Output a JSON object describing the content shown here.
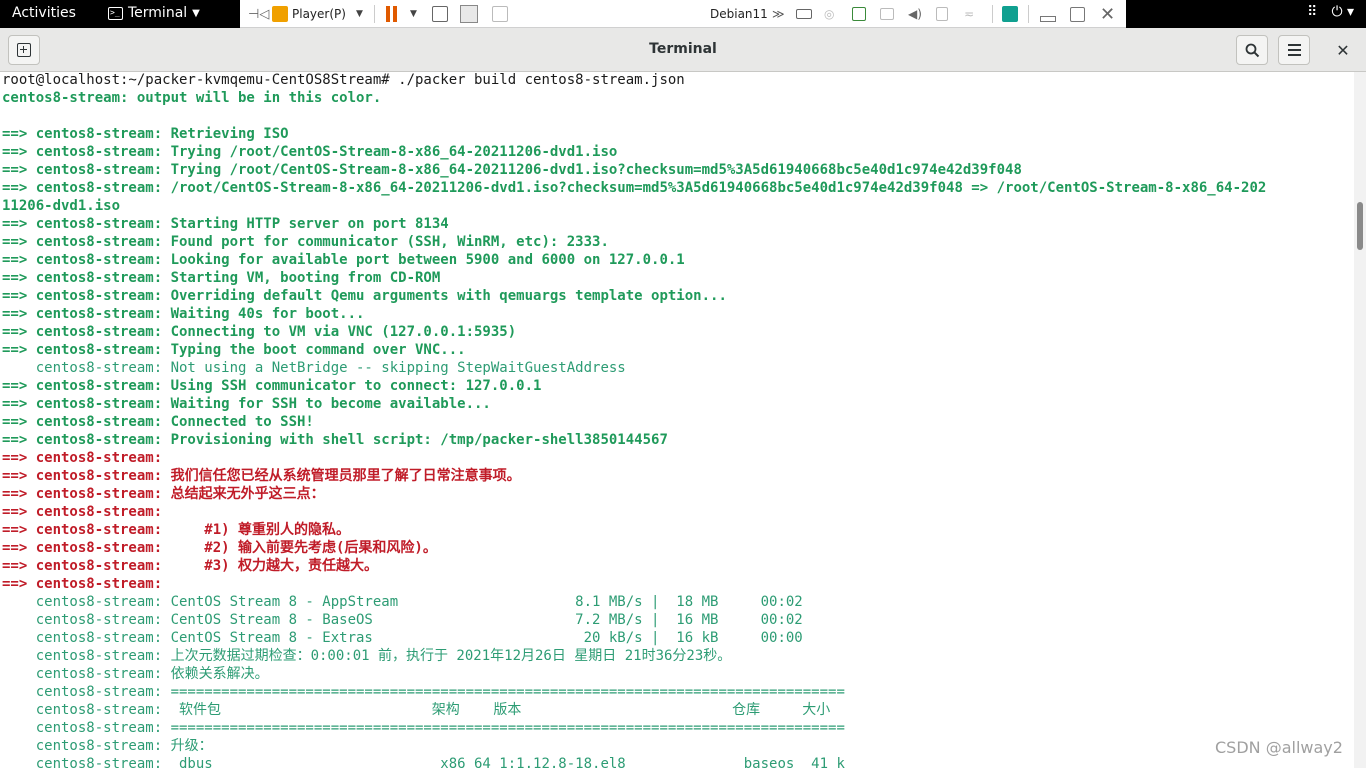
{
  "topbar": {
    "activities": "Activities",
    "app_name": "Terminal"
  },
  "vmware": {
    "player_label": "Player(P)",
    "vm_name": "Debian11"
  },
  "window": {
    "title": "Terminal"
  },
  "colors": {
    "prompt": "#1a1a1a",
    "green": "#1f9a5a",
    "dim_green": "#2d9c74",
    "red": "#c01c28"
  },
  "terminal_lines": [
    {
      "c": "white",
      "t": "root@localhost:~/packer-kvmqemu-CentOS8Stream# ./packer build centos8-stream.json"
    },
    {
      "c": "green",
      "t": "centos8-stream: output will be in this color."
    },
    {
      "c": "green",
      "t": ""
    },
    {
      "c": "green",
      "t": "==> centos8-stream: Retrieving ISO"
    },
    {
      "c": "green",
      "t": "==> centos8-stream: Trying /root/CentOS-Stream-8-x86_64-20211206-dvd1.iso"
    },
    {
      "c": "green",
      "t": "==> centos8-stream: Trying /root/CentOS-Stream-8-x86_64-20211206-dvd1.iso?checksum=md5%3A5d61940668bc5e40d1c974e42d39f048"
    },
    {
      "c": "green",
      "t": "==> centos8-stream: /root/CentOS-Stream-8-x86_64-20211206-dvd1.iso?checksum=md5%3A5d61940668bc5e40d1c974e42d39f048 => /root/CentOS-Stream-8-x86_64-202"
    },
    {
      "c": "green",
      "t": "11206-dvd1.iso"
    },
    {
      "c": "green",
      "t": "==> centos8-stream: Starting HTTP server on port 8134"
    },
    {
      "c": "green",
      "t": "==> centos8-stream: Found port for communicator (SSH, WinRM, etc): 2333."
    },
    {
      "c": "green",
      "t": "==> centos8-stream: Looking for available port between 5900 and 6000 on 127.0.0.1"
    },
    {
      "c": "green",
      "t": "==> centos8-stream: Starting VM, booting from CD-ROM"
    },
    {
      "c": "green",
      "t": "==> centos8-stream: Overriding default Qemu arguments with qemuargs template option..."
    },
    {
      "c": "green",
      "t": "==> centos8-stream: Waiting 40s for boot..."
    },
    {
      "c": "green",
      "t": "==> centos8-stream: Connecting to VM via VNC (127.0.0.1:5935)"
    },
    {
      "c": "green",
      "t": "==> centos8-stream: Typing the boot command over VNC..."
    },
    {
      "c": "dimgreen",
      "t": "    centos8-stream: Not using a NetBridge -- skipping StepWaitGuestAddress"
    },
    {
      "c": "green",
      "t": "==> centos8-stream: Using SSH communicator to connect: 127.0.0.1"
    },
    {
      "c": "green",
      "t": "==> centos8-stream: Waiting for SSH to become available..."
    },
    {
      "c": "green",
      "t": "==> centos8-stream: Connected to SSH!"
    },
    {
      "c": "green",
      "t": "==> centos8-stream: Provisioning with shell script: /tmp/packer-shell3850144567"
    },
    {
      "c": "red",
      "t": "==> centos8-stream:"
    },
    {
      "c": "red",
      "t": "==> centos8-stream: 我们信任您已经从系统管理员那里了解了日常注意事项。"
    },
    {
      "c": "red",
      "t": "==> centos8-stream: 总结起来无外乎这三点："
    },
    {
      "c": "red",
      "t": "==> centos8-stream:"
    },
    {
      "c": "red",
      "t": "==> centos8-stream:     #1) 尊重别人的隐私。"
    },
    {
      "c": "red",
      "t": "==> centos8-stream:     #2) 输入前要先考虑(后果和风险)。"
    },
    {
      "c": "red",
      "t": "==> centos8-stream:     #3) 权力越大，责任越大。"
    },
    {
      "c": "red",
      "t": "==> centos8-stream:"
    },
    {
      "c": "dimgreen",
      "t": "    centos8-stream: CentOS Stream 8 - AppStream                     8.1 MB/s |  18 MB     00:02"
    },
    {
      "c": "dimgreen",
      "t": "    centos8-stream: CentOS Stream 8 - BaseOS                        7.2 MB/s |  16 MB     00:02"
    },
    {
      "c": "dimgreen",
      "t": "    centos8-stream: CentOS Stream 8 - Extras                         20 kB/s |  16 kB     00:00"
    },
    {
      "c": "dimgreen",
      "t": "    centos8-stream: 上次元数据过期检查：0:00:01 前，执行于 2021年12月26日 星期日 21时36分23秒。"
    },
    {
      "c": "dimgreen",
      "t": "    centos8-stream: 依赖关系解决。"
    },
    {
      "c": "dimgreen",
      "t": "    centos8-stream: ================================================================================"
    },
    {
      "c": "dimgreen",
      "t": "    centos8-stream:  软件包                         架构    版本                         仓库     大小"
    },
    {
      "c": "dimgreen",
      "t": "    centos8-stream: ================================================================================"
    },
    {
      "c": "dimgreen",
      "t": "    centos8-stream: 升级："
    },
    {
      "c": "dimgreen",
      "t": "    centos8-stream:  dbus                           x86_64 1:1.12.8-18.el8              baseos  41 k"
    }
  ],
  "watermark": "CSDN @allway2"
}
